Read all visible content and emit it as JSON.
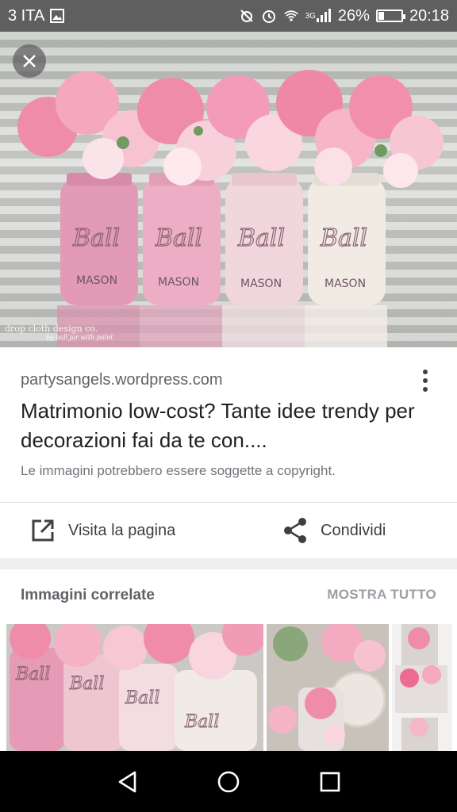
{
  "status_bar": {
    "carrier": "3 ITA",
    "network_type": "3G",
    "battery": "26%",
    "battery_level": 0.26,
    "time": "20:18",
    "icons": [
      "image-icon",
      "alarm-off-icon",
      "alarm-icon",
      "wifi-icon",
      "signal-icon",
      "battery-icon"
    ]
  },
  "hero": {
    "watermark_line1": "drop cloth design co.",
    "watermark_line2": "by ball jar with paint",
    "jar_label": "Ball",
    "jar_sublabel": "MASON"
  },
  "result": {
    "domain": "partysangels.wordpress.com",
    "title": "Matrimonio low-cost? Tante idee trendy per decorazioni fai da te con....",
    "copyright_notice": "Le immagini potrebbero essere soggette a copyright."
  },
  "actions": {
    "visit_label": "Visita la pagina",
    "share_label": "Condividi"
  },
  "related": {
    "title": "Immagini correlate",
    "show_all": "MOSTRA TUTTO"
  },
  "colors": {
    "status_bar_bg": "#5f5f5f",
    "pink": "#f08cab",
    "jar_pink": "#e9a9bf",
    "jar_cream": "#efe7e0"
  }
}
